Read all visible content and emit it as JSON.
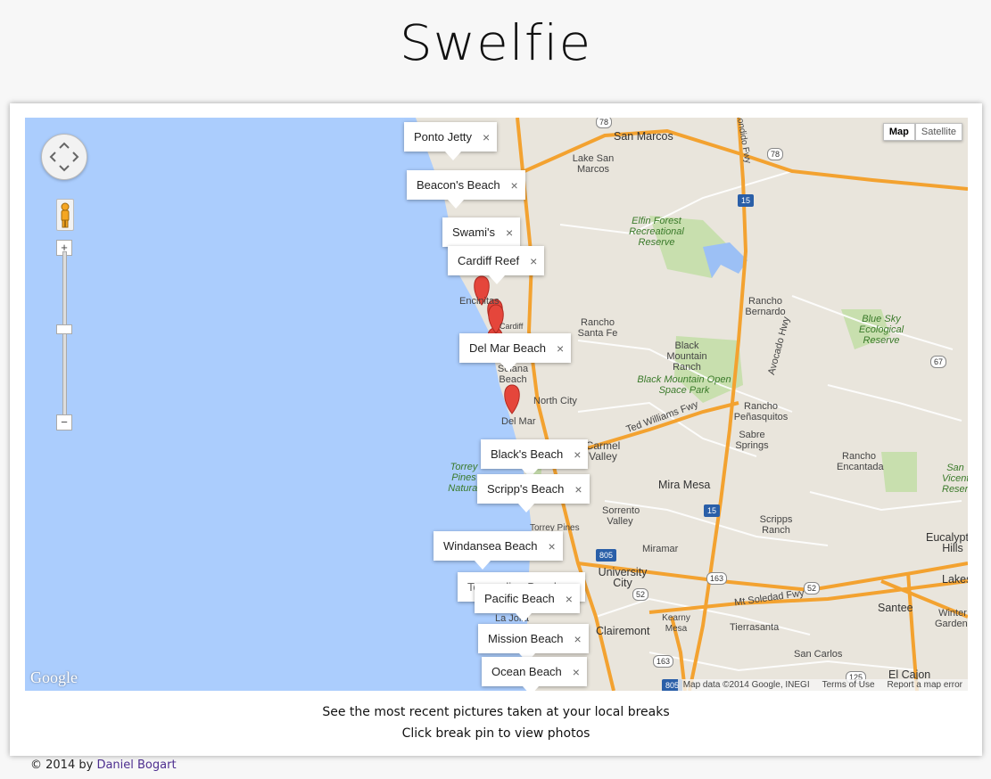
{
  "page": {
    "title": "Swelfie",
    "caption_line1": "See the most recent pictures taken at your local breaks",
    "caption_line2": "Click break pin to view photos",
    "copyright_prefix": "© 2014 by",
    "author": "Daniel Bogart"
  },
  "map": {
    "type_buttons": [
      "Map",
      "Satellite"
    ],
    "active_type": "Map",
    "zoom_in": "+",
    "zoom_out": "−",
    "logo": "Google",
    "map_data": "Map data ©2014 Google, INEGI",
    "terms": "Terms of Use",
    "report": "Report a map error",
    "colors": {
      "ocean": "#abcdfd",
      "land": "#e9e5dc",
      "highway": "#f3a230",
      "road": "#ffffff",
      "park": "#c8dfae",
      "pin": "#e5463b"
    },
    "places": {
      "san_marcos": "San Marcos",
      "lake_san_marcos": "Lake San Marcos",
      "elfin_forest": "Elfin Forest Recreational Reserve",
      "rancho_bernardo": "Rancho Bernardo",
      "blue_sky": "Blue Sky Ecological Reserve",
      "encinitas": "Encinitas",
      "cardiff": "Cardiff",
      "rancho_santa_fe": "Rancho Santa Fe",
      "black_mountain_ranch": "Black Mountain Ranch",
      "black_mountain_park": "Black Mountain Open Space Park",
      "solana_beach": "Solana Beach",
      "north_city": "North City",
      "del_mar": "Del Mar",
      "rancho_penasquitos": "Rancho Peñasquitos",
      "sabre_springs": "Sabre Springs",
      "rancho_encantada": "Rancho Encantada",
      "san_vicente": "San Vicente Reservoir",
      "torrey_pines_natural": "Torrey Pines Natural",
      "carmel_valley": "Carmel Valley",
      "mira_mesa": "Mira Mesa",
      "sorrento_valley": "Sorrento Valley",
      "scripps_ranch": "Scripps Ranch",
      "torrey_pines": "Torrey Pines",
      "miramar": "Miramar",
      "eucalyptus_hills": "Eucalyptus Hills",
      "university_city": "University City",
      "lakeside": "Lakes",
      "santee": "Santee",
      "winter_gardens": "Winter Gardens",
      "la_jolla": "La Jolla",
      "clairemont": "Clairemont",
      "kearny_mesa": "Kearny Mesa",
      "tierrasanta": "Tierrasanta",
      "san_carlos": "San Carlos",
      "el_cajon": "El Cajon",
      "avocado_hwy": "Avocado Hwy",
      "ted_williams_fwy": "Ted Williams Fwy",
      "mt_soledad_fwy": "Mt Soledad Fwy",
      "escondido_fwy": "Escondido Fwy"
    },
    "shields": [
      "78",
      "78",
      "15",
      "67",
      "15",
      "805",
      "52",
      "163",
      "52",
      "163",
      "805",
      "125",
      "67"
    ],
    "pins": [
      {
        "label": "Ponto Jetty",
        "close": "×"
      },
      {
        "label": "Beacon's Beach",
        "close": "×"
      },
      {
        "label": "Swami's",
        "close": "×"
      },
      {
        "label": "Cardiff Reef",
        "close": "×"
      },
      {
        "label": "Del Mar Beach",
        "close": "×"
      },
      {
        "label": "Black's Beach",
        "close": "×"
      },
      {
        "label": "Scripp's Beach",
        "close": "×"
      },
      {
        "label": "Windansea Beach",
        "close": "×"
      },
      {
        "label": "Tourmaline Beach",
        "close": "×"
      },
      {
        "label": "Pacific Beach",
        "close": "×"
      },
      {
        "label": "Mission Beach",
        "close": "×"
      },
      {
        "label": "Ocean Beach",
        "close": "×"
      }
    ]
  }
}
